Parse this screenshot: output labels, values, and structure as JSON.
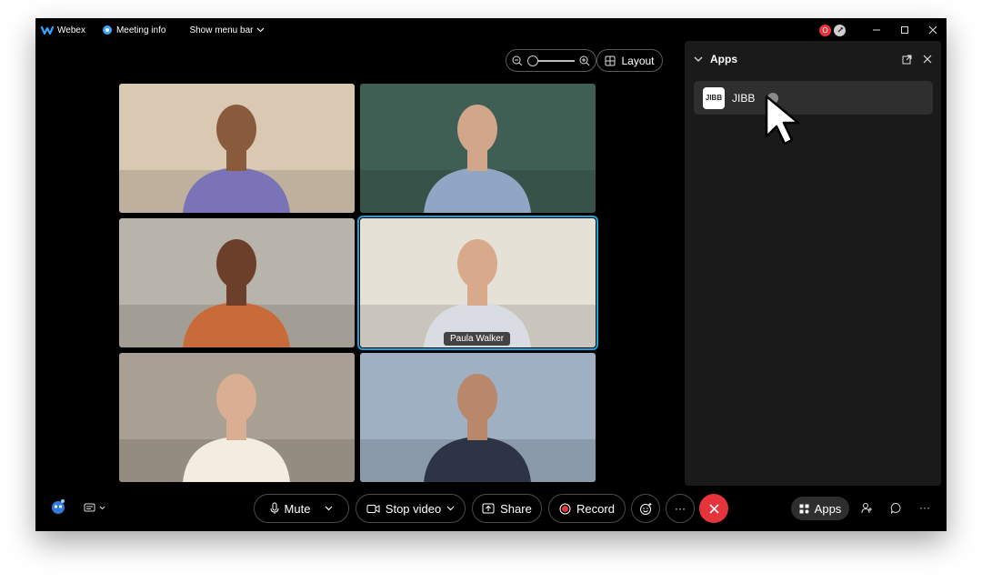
{
  "titlebar": {
    "app_name": "Webex",
    "meeting_info": "Meeting info",
    "menu_bar": "Show menu bar",
    "notification_badge": "O"
  },
  "controls": {
    "layout_label": "Layout"
  },
  "participants": [
    {
      "name": "",
      "active": false,
      "skin": "#8a5a3c",
      "shirt": "#7a73b8",
      "bg": "#d9c9b3"
    },
    {
      "name": "",
      "active": false,
      "skin": "#d2a68a",
      "shirt": "#8fa7c4",
      "bg": "#3f5e54"
    },
    {
      "name": "",
      "active": false,
      "skin": "#6b3f2a",
      "shirt": "#c96a3a",
      "bg": "#b9b4ab"
    },
    {
      "name": "Paula Walker",
      "active": true,
      "skin": "#d8a98a",
      "shirt": "#d9dde3",
      "bg": "#e6e1d6"
    },
    {
      "name": "",
      "active": false,
      "skin": "#d9ae93",
      "shirt": "#f3ece0",
      "bg": "#a9a093"
    },
    {
      "name": "",
      "active": false,
      "skin": "#b9876a",
      "shirt": "#2c3445",
      "bg": "#9eb0c2"
    }
  ],
  "apps_panel": {
    "title": "Apps",
    "items": [
      {
        "label": "JIBB",
        "logo_text": "JIBB"
      }
    ]
  },
  "toolbar": {
    "mute_label": "Mute",
    "stop_video_label": "Stop video",
    "share_label": "Share",
    "record_label": "Record",
    "more_label": "···",
    "apps_label": "Apps",
    "overflow_label": "···"
  },
  "colors": {
    "accent_active_border": "#1aa3d8",
    "end_call": "#e5343c",
    "record_dot": "#e5343c"
  }
}
